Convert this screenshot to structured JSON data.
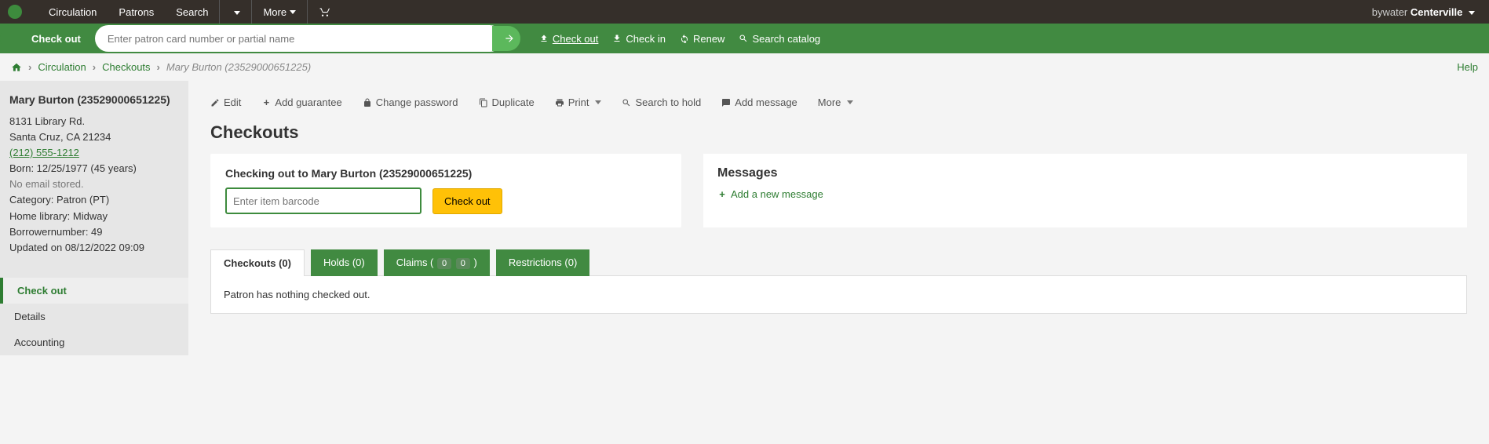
{
  "top_nav": {
    "items": [
      "Circulation",
      "Patrons",
      "Search"
    ],
    "more_label": "More",
    "account_prefix": "bywater",
    "account_branch": "Centerville"
  },
  "green_bar": {
    "pill_label": "Check out",
    "search_placeholder": "Enter patron card number or partial name",
    "links": {
      "checkout": "Check out",
      "checkin": "Check in",
      "renew": "Renew",
      "catalog": "Search catalog"
    }
  },
  "breadcrumb": {
    "home_label": "Home",
    "items": [
      "Circulation",
      "Checkouts",
      "Mary Burton (23529000651225)"
    ],
    "help": "Help"
  },
  "patron": {
    "name_line": "Mary Burton (23529000651225)",
    "address1": "8131 Library Rd.",
    "address2": "Santa Cruz, CA 21234",
    "phone": "(212) 555-1212",
    "born": "Born: 12/25/1977 (45 years)",
    "no_email": "No email stored.",
    "category": "Category: Patron (PT)",
    "home_library": "Home library: Midway",
    "borrower_no": "Borrowernumber: 49",
    "updated": "Updated on 08/12/2022 09:09"
  },
  "side_nav": {
    "items": [
      "Check out",
      "Details",
      "Accounting"
    ],
    "active_index": 0
  },
  "toolbar": {
    "edit": "Edit",
    "add_guarantee": "Add guarantee",
    "change_password": "Change password",
    "duplicate": "Duplicate",
    "print": "Print",
    "search_to_hold": "Search to hold",
    "add_message": "Add message",
    "more": "More"
  },
  "main": {
    "page_title": "Checkouts",
    "checkout_panel": {
      "heading_prefix": "Checking out to",
      "heading_name": "Mary Burton (23529000651225)",
      "input_placeholder": "Enter item barcode",
      "button": "Check out"
    },
    "messages_panel": {
      "title": "Messages",
      "add_new": "Add a new message"
    },
    "tabs": {
      "checkouts_label": "Checkouts (0)",
      "holds_label": "Holds (0)",
      "claims_label_prefix": "Claims (",
      "claims_badge1": "0",
      "claims_badge2": "0",
      "claims_label_suffix": ")",
      "restrictions_label": "Restrictions (0)"
    },
    "tab_content": {
      "empty": "Patron has nothing checked out."
    }
  }
}
